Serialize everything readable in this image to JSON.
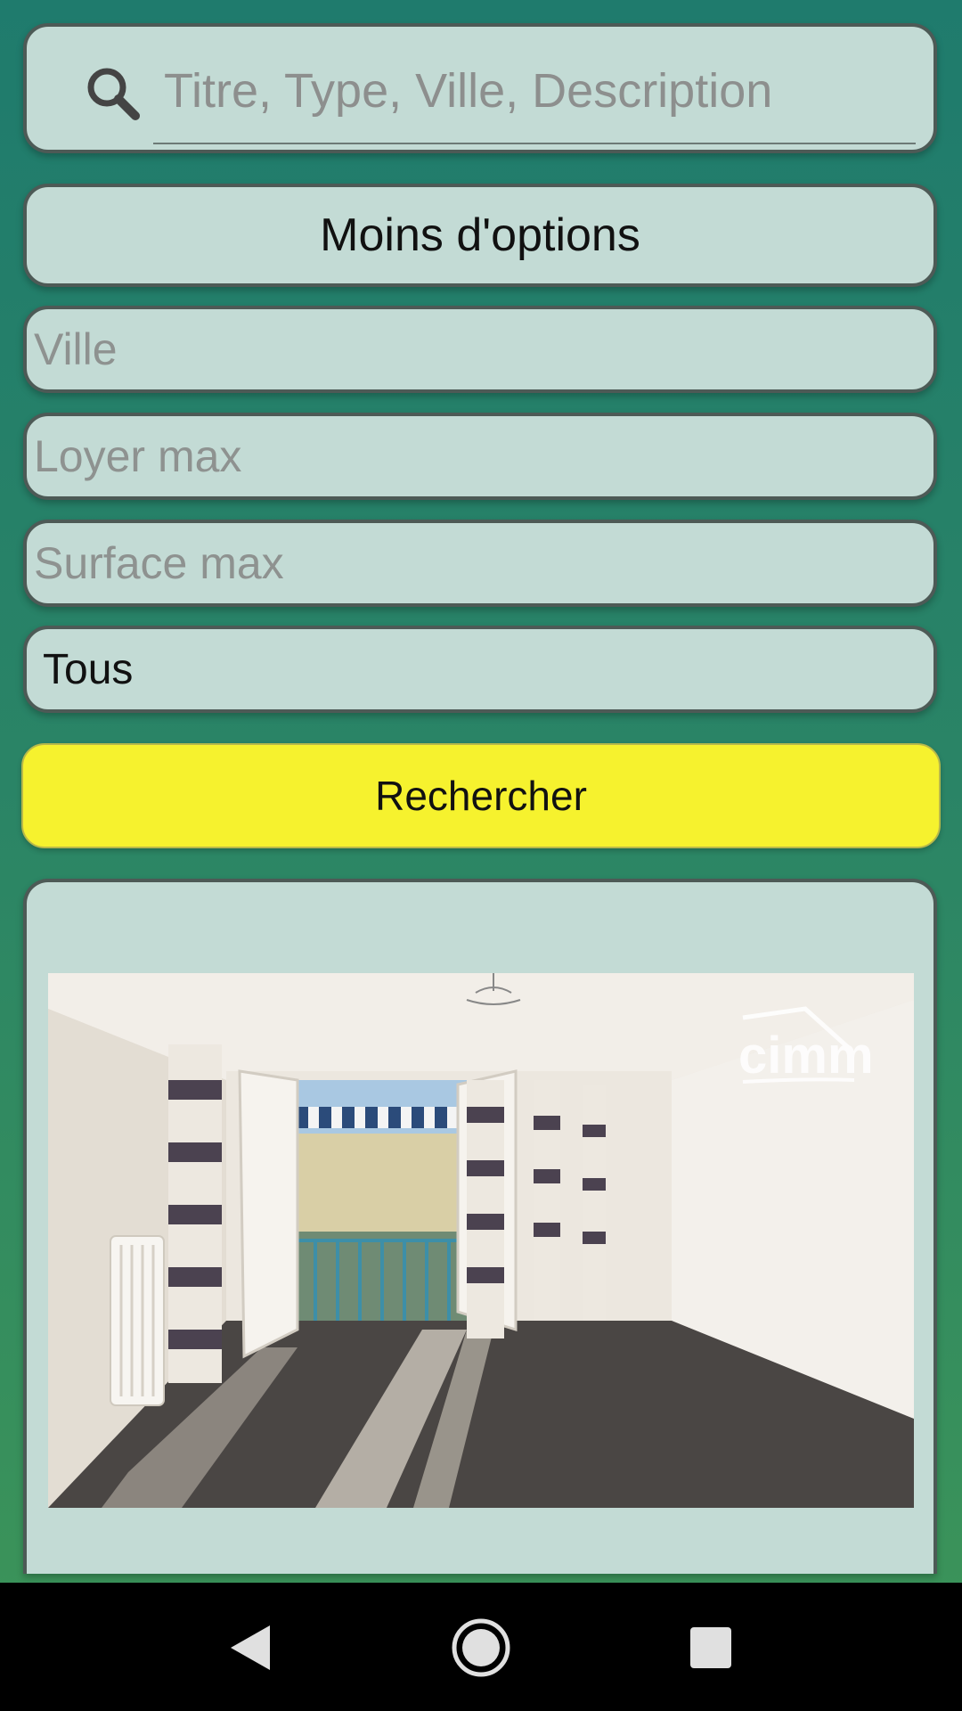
{
  "search": {
    "placeholder": "Titre, Type, Ville, Description",
    "icon": "search-icon"
  },
  "options_toggle": {
    "label": "Moins d'options"
  },
  "filters": {
    "ville_placeholder": "Ville",
    "loyer_placeholder": "Loyer max",
    "surface_placeholder": "Surface max",
    "type_selected": "Tous"
  },
  "search_button": {
    "label": "Rechercher"
  },
  "listing": {
    "watermark": "cimm"
  },
  "navbar": {
    "back_icon": "back-triangle-icon",
    "home_icon": "home-circle-icon",
    "recents_icon": "recents-square-icon"
  },
  "colors": {
    "background_top": "#1f7b6d",
    "background_bottom": "#3d9558",
    "panel": "#c3dbd5",
    "button_accent": "#f6f22e"
  }
}
